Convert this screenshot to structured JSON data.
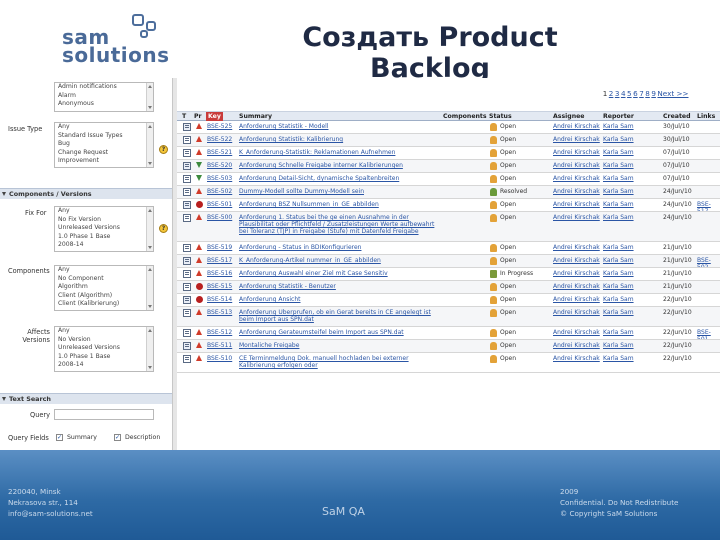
{
  "slide": {
    "title": "Создать Product Backlog",
    "logo": {
      "line1": "sam",
      "line2": "solutions"
    }
  },
  "filter": {
    "project_list": [
      "Admin notifications",
      "Alarm",
      "Anonymous"
    ],
    "issue_type_label": "Issue Type",
    "issue_type_list": [
      "Any",
      "Standard Issue Types",
      "Bug",
      "Change Request",
      "Improvement"
    ],
    "components_section": "Components / Versions",
    "fix_for_label": "Fix For",
    "fix_for_list": [
      "Any",
      "No Fix Version",
      "Unreleased Versions",
      "1.0 Phase 1 Base",
      "2008-14"
    ],
    "components_label": "Components",
    "components_list": [
      "Any",
      "No Component",
      "Algorithm",
      "Client (Algorithm)",
      "Client (Kalibrierung)"
    ],
    "affects_label": "Affects Versions",
    "affects_list": [
      "Any",
      "No Version",
      "Unreleased Versions",
      "1.0 Phase 1 Base",
      "2008-14"
    ],
    "text_search_section": "Text Search",
    "query_label": "Query",
    "fields_label": "Query Fields",
    "cb_summary": "Summary",
    "cb_description": "Description"
  },
  "results": {
    "pager": {
      "pages": [
        "1",
        "2",
        "3",
        "4",
        "5",
        "6",
        "7",
        "8",
        "9"
      ],
      "next": "Next >>"
    },
    "columns": {
      "t": "T",
      "pr": "Pr",
      "key": "Key",
      "summary": "Summary",
      "components": "Components",
      "status": "Status",
      "assignee": "Assignee",
      "reporter": "Reporter",
      "created": "Created",
      "links": "Links"
    },
    "rows": [
      {
        "key": "BSE-525",
        "summary": "Anforderung Statistik - Modell",
        "status": "Open",
        "assignee": "Andrei Kirschak",
        "reporter": "Karla Sam",
        "created": "30/Jul/10",
        "links": "",
        "prio": "up",
        "stype": "open"
      },
      {
        "key": "BSE-522",
        "summary": "Anforderung Statistik: Kalibrierung",
        "status": "Open",
        "assignee": "Andrei Kirschak",
        "reporter": "Karla Sam",
        "created": "30/Jul/10",
        "links": "",
        "prio": "up",
        "stype": "open"
      },
      {
        "key": "BSE-521",
        "summary": "K_Anforderung-Statistik: Reklamationen Aufnehmen",
        "status": "Open",
        "assignee": "Andrei Kirschak",
        "reporter": "Karla Sam",
        "created": "07/Jul/10",
        "links": "",
        "prio": "up",
        "stype": "open"
      },
      {
        "key": "BSE-520",
        "summary": "Anforderung Schnelle Freigabe interner Kalibrierungen",
        "status": "Open",
        "assignee": "Andrei Kirschak",
        "reporter": "Karla Sam",
        "created": "07/Jul/10",
        "links": "",
        "prio": "down",
        "stype": "open"
      },
      {
        "key": "BSE-503",
        "summary": "Anforderung Detail-Sicht, dynamische Spaltenbreiten",
        "status": "Open",
        "assignee": "Andrei Kirschak",
        "reporter": "Karla Sam",
        "created": "07/Jul/10",
        "links": "",
        "prio": "down",
        "stype": "open"
      },
      {
        "key": "BSE-502",
        "summary": "Dummy-Modell sollte Dummy-Modell sein",
        "status": "Resolved",
        "assignee": "Andrei Kirschak",
        "reporter": "Karla Sam",
        "created": "24/Jun/10",
        "links": "",
        "prio": "up",
        "stype": "resolved"
      },
      {
        "key": "BSE-501",
        "summary": "Anforderung BSZ Nullsummen_in_GE_abbilden",
        "status": "Open",
        "assignee": "Andrei Kirschak",
        "reporter": "Karla Sam",
        "created": "24/Jun/10",
        "links": "BSE-517",
        "prio": "blocker",
        "stype": "open"
      },
      {
        "key": "BSE-500",
        "summary": "Anforderung 1. Status bei the ge einen Ausnahme in der Plausibilitat oder Pflichtfeld / Zusatzleistungen Werte aufbewahrt bei Toleranz (TJP) in Freigabe (Stufe) mit Datenfeld Freigabe",
        "status": "Open",
        "assignee": "Andrei Kirschak",
        "reporter": "Karla Sam",
        "created": "24/Jun/10",
        "links": "",
        "prio": "up",
        "stype": "open"
      },
      {
        "key": "BSE-519",
        "summary": "Anforderung - Status in BDIKonfigurieren",
        "status": "Open",
        "assignee": "Andrei Kirschak",
        "reporter": "Karla Sam",
        "created": "21/Jun/10",
        "links": "",
        "prio": "up",
        "stype": "open"
      },
      {
        "key": "BSE-517",
        "summary": "K_Anforderung-Artikel nummer_in_GE_abbilden",
        "status": "Open",
        "assignee": "Andrei Kirschak",
        "reporter": "Karla Sam",
        "created": "21/Jun/10",
        "links": "BSE-502",
        "prio": "up",
        "stype": "open"
      },
      {
        "key": "BSE-516",
        "summary": "Anforderung Auswahl einer Ziel mit Case Sensitiv",
        "status": "In Progress",
        "assignee": "Andrei Kirschak",
        "reporter": "Karla Sam",
        "created": "21/Jun/10",
        "links": "",
        "prio": "up",
        "stype": "progress"
      },
      {
        "key": "BSE-515",
        "summary": "Anforderung Statistik - Benutzer",
        "status": "Open",
        "assignee": "Andrei Kirschak",
        "reporter": "Karla Sam",
        "created": "21/Jun/10",
        "links": "",
        "prio": "blocker",
        "stype": "open"
      },
      {
        "key": "BSE-514",
        "summary": "Anforderung Ansicht",
        "status": "Open",
        "assignee": "Andrei Kirschak",
        "reporter": "Karla Sam",
        "created": "22/Jun/10",
        "links": "",
        "prio": "blocker",
        "stype": "open"
      },
      {
        "key": "BSE-513",
        "summary": "Anforderung Uberprufen, ob ein Gerat bereits in CE angelegt ist beim Import aus SPN.dat",
        "status": "Open",
        "assignee": "Andrei Kirschak",
        "reporter": "Karla Sam",
        "created": "22/Jun/10",
        "links": "",
        "prio": "up",
        "stype": "open"
      },
      {
        "key": "BSE-512",
        "summary": "Anforderung Gerateumsteifel beim Import aus SPN.dat",
        "status": "Open",
        "assignee": "Andrei Kirschak",
        "reporter": "Karla Sam",
        "created": "22/Jun/10",
        "links": "BSE-501",
        "prio": "up",
        "stype": "open"
      },
      {
        "key": "BSE-511",
        "summary": "Montaliche Freigabe",
        "status": "Open",
        "assignee": "Andrei Kirschak",
        "reporter": "Karla Sam",
        "created": "22/Jun/10",
        "links": "",
        "prio": "up",
        "stype": "open"
      },
      {
        "key": "BSE-510",
        "summary": "CE Terminmeldung Dok. manuell hochladen bei externer Kalibrierung erfolgen oder",
        "status": "Open",
        "assignee": "Andrei Kirschak",
        "reporter": "Karla Sam",
        "created": "22/Jun/10",
        "links": "",
        "prio": "up",
        "stype": "open"
      }
    ]
  },
  "footer": {
    "address_line1": "220040, Minsk",
    "address_line2": "Nekrasova str., 114",
    "address_line3": "info@sam-solutions.net",
    "center": "SaM QA",
    "year": "2009",
    "confidential": "Confidential. Do Not Redistribute",
    "copyright": "© Copyright SaM Solutions"
  }
}
